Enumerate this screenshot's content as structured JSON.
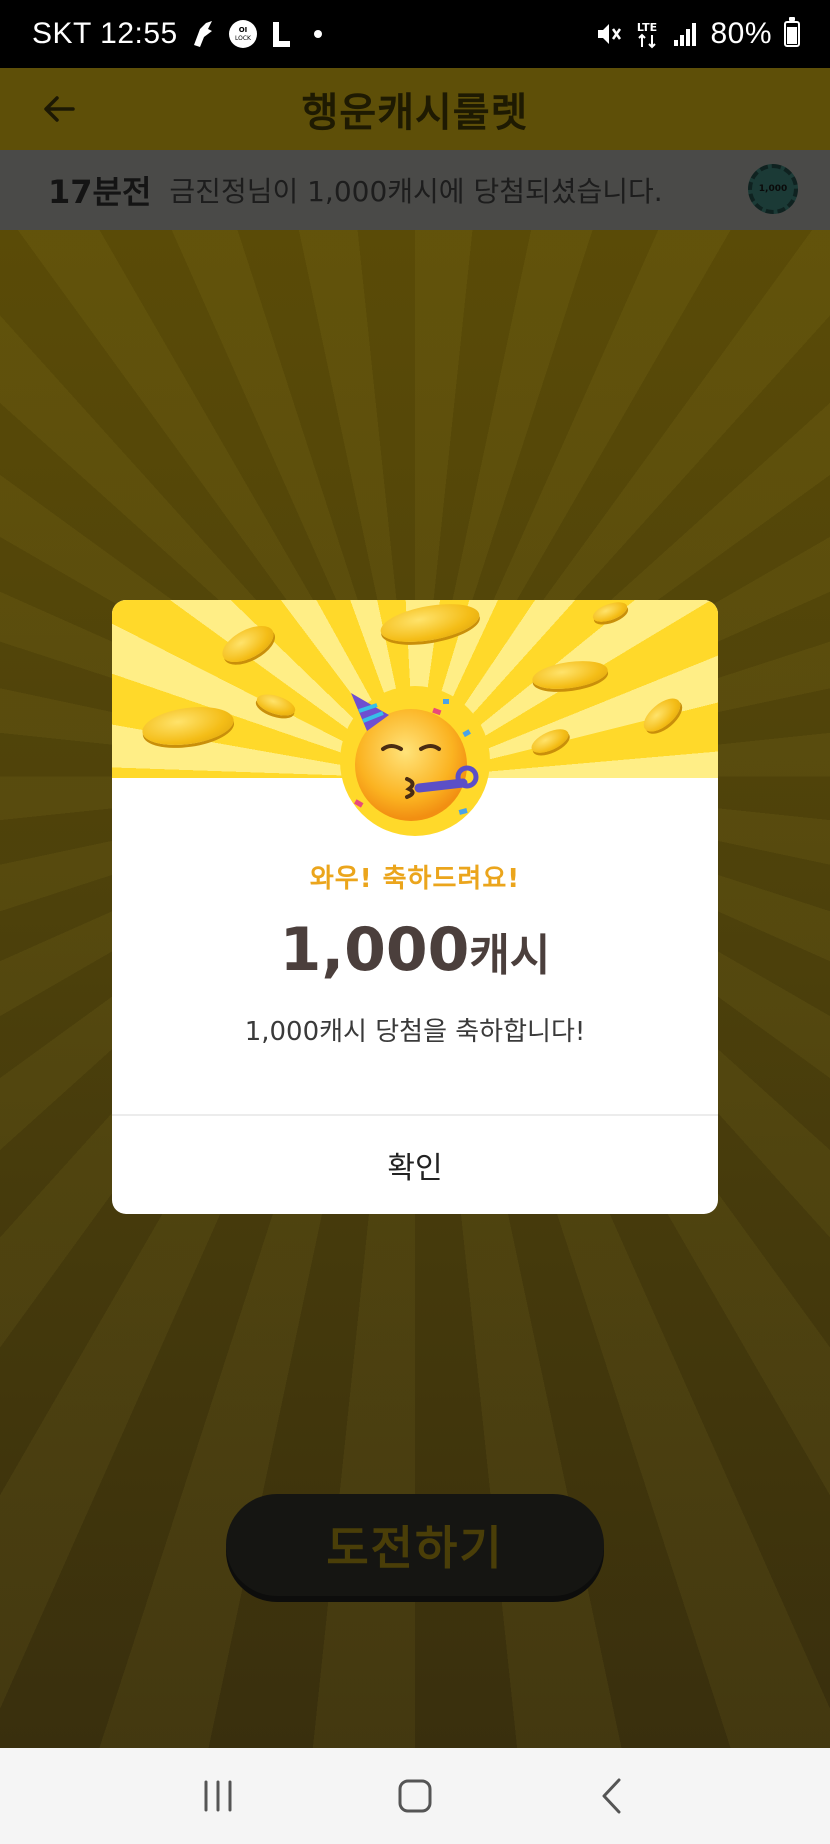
{
  "status_bar": {
    "carrier_time": "SKT 12:55",
    "network": "LTE",
    "battery": "80%",
    "battery_level": 0.8,
    "icons": [
      "bird-icon",
      "oi-lock-icon",
      "l-app-icon",
      "dot-icon",
      "mute-icon",
      "lte-icon",
      "signal-icon",
      "battery-icon"
    ]
  },
  "header": {
    "title": "행운캐시룰렛",
    "back_icon": "arrow-left-icon"
  },
  "ticker": {
    "time_ago": "17분전",
    "message": "금진정님이 1,000캐시에 당첨되셨습니다.",
    "badge_text": "1,000"
  },
  "main": {
    "challenge_label": "도전하기"
  },
  "dialog": {
    "headline": "와우! 축하드려요!",
    "amount": "1,000",
    "unit": "캐시",
    "description": "1,000캐시 당첨을 축하합니다!",
    "confirm_label": "확인",
    "emoji": "partying-face-icon"
  },
  "nav_bar": {
    "items": [
      "recent-apps-icon",
      "home-icon",
      "back-icon"
    ]
  },
  "colors": {
    "banner_yellow": "#ffd92a",
    "headline_orange": "#eba51c",
    "amount_brown": "#4b3f3c"
  }
}
